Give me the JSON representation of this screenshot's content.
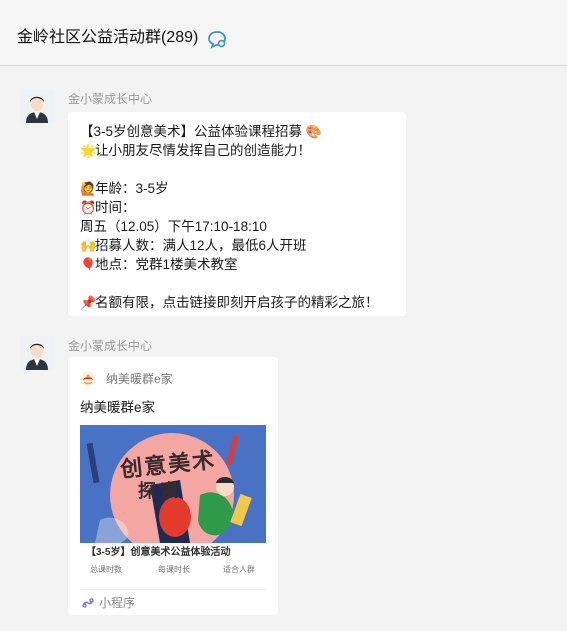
{
  "header": {
    "title": "金岭社区公益活动群(289)",
    "icon": "chat-bubble-icon"
  },
  "colors": {
    "accent": "#3a8ee6",
    "bubble": "#ffffff",
    "background": "#f3f3f3"
  },
  "messages": [
    {
      "sender": "金小蒙成长中心",
      "avatar": "avatar-cartoon-man",
      "lines": {
        "l1": "【3-5岁创意美术】公益体验课程招募",
        "l2": "让小朋友尽情发挥自己的创造能力！",
        "l3": "年龄：3-5岁",
        "l4": "时间：",
        "l5": "周五（12.05）下午17:10-18:10",
        "l6": "招募人数：满人12人，最低6人开班",
        "l7": "地点：党群1楼美术教室",
        "l8": "名额有限，点击链接即刻开启孩子的精彩之旅！"
      },
      "emojis": {
        "e1": "🎨",
        "e2": "🌟",
        "e3": "🙋",
        "e4": "⏰",
        "e5": "🙌",
        "e6": "🎈",
        "e7": "📌"
      }
    },
    {
      "sender": "金小蒙成长中心",
      "avatar": "avatar-cartoon-man",
      "card": {
        "source_name": "纳美暖群e家",
        "title": "纳美暖群e家",
        "poster_heading": "创意美术",
        "poster_subheading": "探索",
        "poster_title": "【3-5岁】创意美术公益体验活动",
        "stats": [
          "总课时数",
          "每课时长",
          "适合人群"
        ],
        "footer_label": "小程序",
        "footer_icon": "mini-program-icon"
      }
    }
  ]
}
